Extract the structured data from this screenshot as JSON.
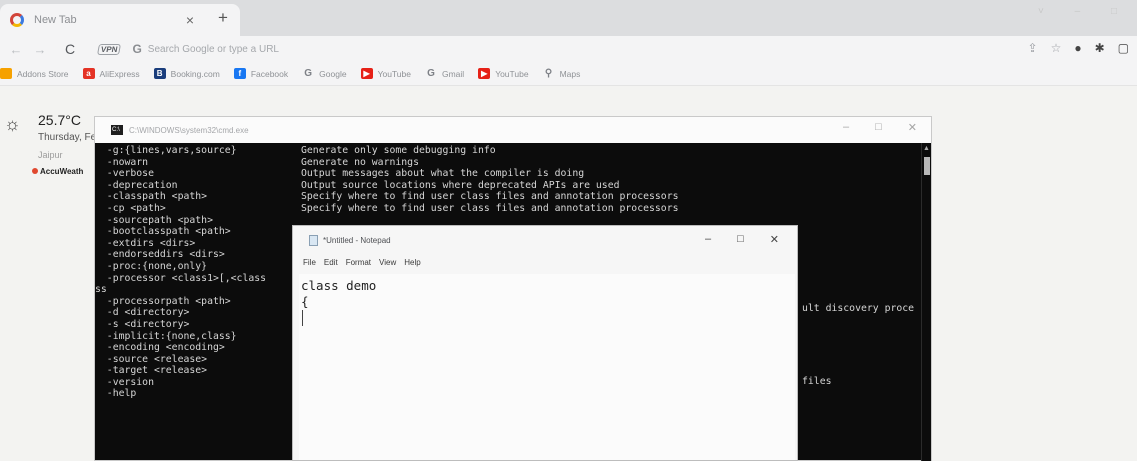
{
  "browser": {
    "tab_title": "New Tab",
    "tab_close": "×",
    "new_tab": "+",
    "window_controls": "˅ – □",
    "back": "←",
    "forward": "→",
    "reload": "C",
    "vpn_badge": "VPN",
    "google_g": "G",
    "omnibox_placeholder": "Search Google or type a URL",
    "toolbar_icons": [
      "share-icon",
      "star-icon",
      "opera-icon",
      "extensions-icon",
      "sidebar-icon"
    ],
    "bookmarks": [
      {
        "label": "Addons Store",
        "icon": "addons-icon",
        "color": "#f6a100",
        "glyph": ""
      },
      {
        "label": "AliExpress",
        "icon": "aliexpress-icon",
        "color": "#e43225",
        "glyph": "a"
      },
      {
        "label": "Booking.com",
        "icon": "booking-icon",
        "color": "#1a3d7c",
        "glyph": "B"
      },
      {
        "label": "Facebook",
        "icon": "facebook-icon",
        "color": "#1877f2",
        "glyph": "f"
      },
      {
        "label": "Google",
        "icon": "google-icon",
        "color": "transparent",
        "glyph": "G"
      },
      {
        "label": "YouTube",
        "icon": "youtube-icon",
        "color": "#e62117",
        "glyph": "▶"
      },
      {
        "label": "Gmail",
        "icon": "gmail-icon",
        "color": "transparent",
        "glyph": "G"
      },
      {
        "label": "YouTube",
        "icon": "youtube-icon",
        "color": "#e62117",
        "glyph": "▶"
      },
      {
        "label": "Maps",
        "icon": "maps-icon",
        "color": "transparent",
        "glyph": "⚲"
      }
    ]
  },
  "weather": {
    "temperature": "25.7°C",
    "date": "Thursday, Fe",
    "city": "Jaipur",
    "source": "AccuWeath"
  },
  "cmd": {
    "title": "C:\\WINDOWS\\system32\\cmd.exe",
    "options": [
      "  -g:{lines,vars,source}",
      "  -nowarn",
      "  -verbose",
      "  -deprecation",
      "  -classpath <path>",
      "  -cp <path>",
      "  -sourcepath <path>",
      "  -bootclasspath <path>",
      "  -extdirs <dirs>",
      "  -endorseddirs <dirs>",
      "  -proc:{none,only}",
      "  -processor <class1>[,<class",
      "ss",
      "  -processorpath <path>",
      "  -d <directory>",
      "  -s <directory>",
      "  -implicit:{none,class}",
      "  -encoding <encoding>",
      "  -source <release>",
      "  -target <release>",
      "  -version",
      "  -help"
    ],
    "descriptions": [
      "Generate only some debugging info",
      "Generate no warnings",
      "Output messages about what the compiler is doing",
      "Output source locations where deprecated APIs are used",
      "Specify where to find user class files and annotation processors",
      "Specify where to find user class files and annotation processors"
    ],
    "tail_1": "ult discovery proce",
    "tail_2": "files"
  },
  "notepad": {
    "title": "*Untitled - Notepad",
    "menu": [
      "File",
      "Edit",
      "Format",
      "View",
      "Help"
    ],
    "lines": [
      "class demo",
      "{"
    ]
  }
}
